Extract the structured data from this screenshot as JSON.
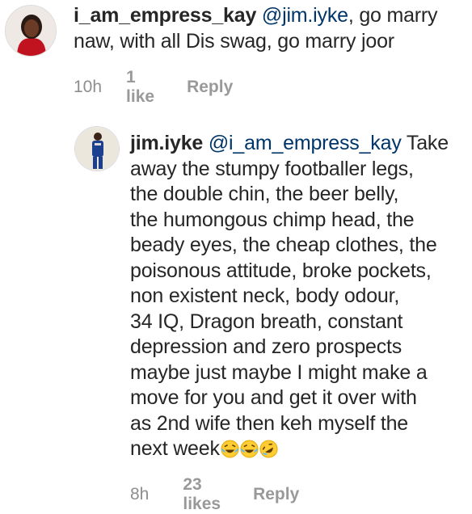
{
  "comments": [
    {
      "username": "i_am_empress_kay",
      "mention": "@jim.iyke",
      "text_line1_rest": ", go marry",
      "text_rest": "naw, with all Dis swag, go marry joor",
      "time": "10h",
      "likes": "1 like",
      "reply": "Reply"
    },
    {
      "username": "jim.iyke",
      "mention": "@i_am_empress_kay",
      "text_line1_rest": " Take",
      "text_rest": "away the stumpy footballer legs,\nthe double chin, the beer belly,\nthe humongous chimp head, the\nbeady eyes, the cheap clothes, the\npoisonous attitude, broke pockets,\nnon existent neck, body odour,\n34 IQ, Dragon breath, constant\ndepression and zero prospects\nmaybe just maybe I might make a\nmove for you and get it over with\nas 2nd wife then keh myself the\nnext week",
      "emojis": [
        "laughing-crying-emoji",
        "laughing-crying-emoji",
        "rolling-laughing-emoji"
      ],
      "time": "8h",
      "likes": "23 likes",
      "reply": "Reply"
    }
  ],
  "colors": {
    "mention": "#003569",
    "meta": "#8e8e8e",
    "emoji_face": "#ffcc33"
  }
}
